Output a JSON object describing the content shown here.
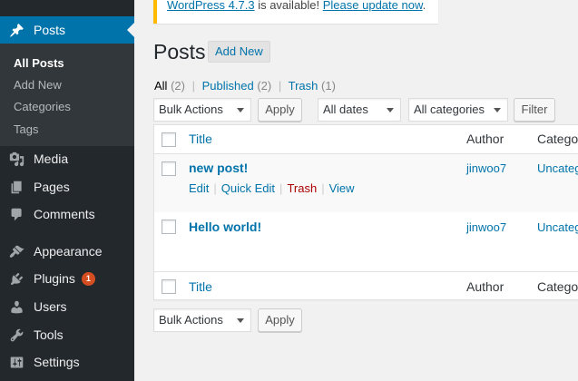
{
  "sidebar": {
    "items": [
      {
        "label": "Posts",
        "icon": "pin-icon"
      },
      {
        "label": "Media",
        "icon": "media-icon"
      },
      {
        "label": "Pages",
        "icon": "pages-icon"
      },
      {
        "label": "Comments",
        "icon": "comments-icon"
      },
      {
        "label": "Appearance",
        "icon": "appearance-icon"
      },
      {
        "label": "Plugins",
        "icon": "plugins-icon",
        "badge": "1"
      },
      {
        "label": "Users",
        "icon": "users-icon"
      },
      {
        "label": "Tools",
        "icon": "tools-icon"
      },
      {
        "label": "Settings",
        "icon": "settings-icon"
      }
    ],
    "submenu": [
      "All Posts",
      "Add New",
      "Categories",
      "Tags"
    ],
    "colors": {
      "background": "#23282d",
      "active": "#0073aa",
      "submenu": "#32373c",
      "badge": "#d54e21"
    }
  },
  "notice": {
    "prefix": "WordPress 4.7.3",
    "middle": " is available! ",
    "link": "Please update now",
    "suffix": "."
  },
  "page": {
    "title": "Posts",
    "add_new": "Add New"
  },
  "filters": {
    "all_label": "All",
    "all_count": "(2)",
    "published_label": "Published",
    "published_count": "(2)",
    "trash_label": "Trash",
    "trash_count": "(1)",
    "separator": "|"
  },
  "toolbar": {
    "bulk_actions": "Bulk Actions",
    "apply": "Apply",
    "dates": "All dates",
    "categories": "All categories",
    "filter": "Filter"
  },
  "table": {
    "columns": {
      "title": "Title",
      "author": "Author",
      "categories": "Categor"
    },
    "rows": [
      {
        "title": "new post!",
        "author": "jinwoo7",
        "category": "Uncateg",
        "actions": {
          "edit": "Edit",
          "quick_edit": "Quick Edit",
          "trash": "Trash",
          "view": "View"
        }
      },
      {
        "title": "Hello world!",
        "author": "jinwoo7",
        "category": "Uncateg"
      }
    ]
  }
}
